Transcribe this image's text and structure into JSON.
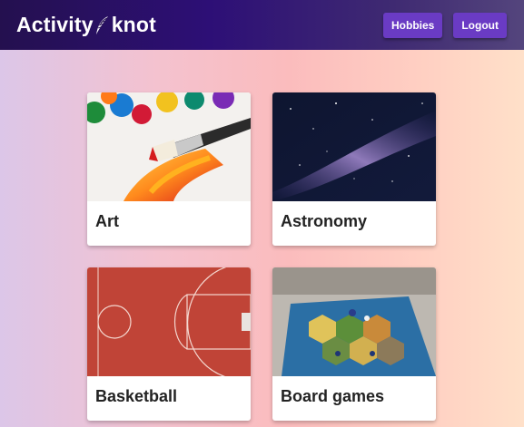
{
  "header": {
    "brand_part1": "Activity",
    "brand_part2": "knot",
    "nav": {
      "hobbies_label": "Hobbies",
      "logout_label": "Logout"
    }
  },
  "cards": [
    {
      "title": "Art",
      "image": "paintbrush-photo"
    },
    {
      "title": "Astronomy",
      "image": "milky-way-photo"
    },
    {
      "title": "Basketball",
      "image": "basketball-court-photo"
    },
    {
      "title": "Board games",
      "image": "board-game-photo"
    }
  ],
  "colors": {
    "nav_gradient_start": "#24104f",
    "nav_gradient_end": "#54457d",
    "button": "#6a3bc4",
    "card_title": "#222222"
  }
}
